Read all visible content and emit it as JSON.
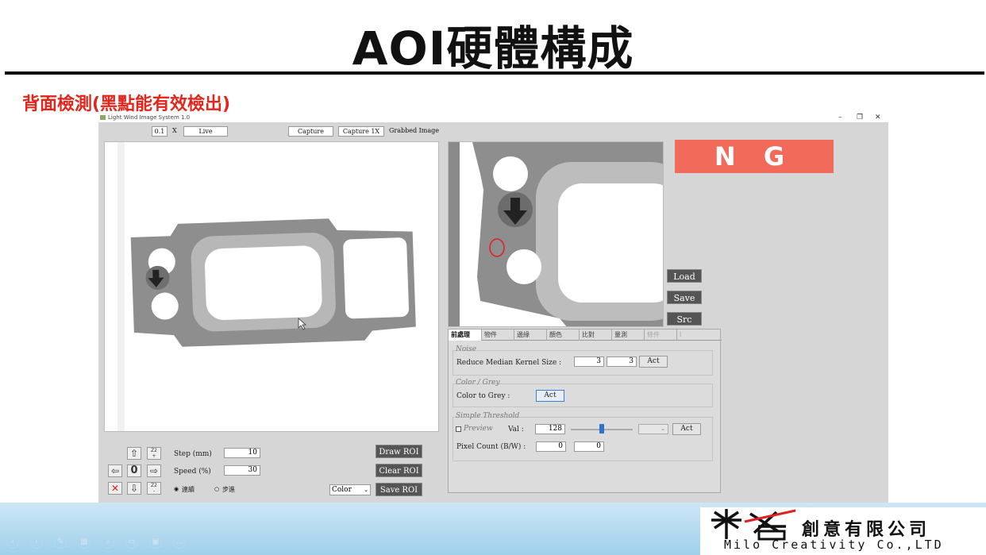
{
  "slide": {
    "title": "AOI硬體構成",
    "subtitle": "背面檢測(黑點能有效檢出)"
  },
  "app": {
    "window_title": "Light Wind Image System 1.0",
    "toolbar": {
      "exposure_value": "0.1",
      "multiply_label": "X",
      "live_label": "Live",
      "capture_label": "Capture",
      "capture_1x_label": "Capture 1X",
      "grabbed_label": "Grabbed Image"
    },
    "result": "N G",
    "side_buttons": {
      "load": "Load",
      "save": "Save",
      "src": "Src"
    },
    "tabs": [
      "前處理",
      "物件",
      "邊緣",
      "顏色",
      "比對",
      "量測",
      "條件",
      "I"
    ],
    "noise": {
      "group_label": "Noise",
      "label": "Reduce Median Kernel Size :",
      "value1": "3",
      "value2": "3",
      "act": "Act"
    },
    "color_grey": {
      "group_label": "Color / Grey",
      "label": "Color to Grey :",
      "act": "Act"
    },
    "threshold": {
      "group_label": "Simple Threshold",
      "preview_label": "Preview",
      "val_label": "Val :",
      "val": "128",
      "slider_level": 0.5,
      "act": "Act",
      "pixel_count_label": "Pixel Count (B/W) :",
      "black_count": "0",
      "white_count": "0"
    },
    "motion": {
      "step_label": "Step (mm)",
      "step_value": "10",
      "speed_label": "Speed (%)",
      "speed_value": "30",
      "zero_label": "0",
      "z2_up": "Z2",
      "z2_down": "Z2",
      "mode_continuous": "連續",
      "mode_step": "步進"
    },
    "roi": {
      "draw": "Draw ROI",
      "clear": "Clear ROI",
      "save": "Save ROI",
      "color_select": "Color"
    }
  },
  "company": {
    "name_cn": "創意有限公司",
    "name_en": "Milo Creativity Co.,LTD"
  },
  "colors": {
    "accent_red": "#e2261b",
    "ng_background": "#f26b5a",
    "button_dark": "#555555"
  }
}
